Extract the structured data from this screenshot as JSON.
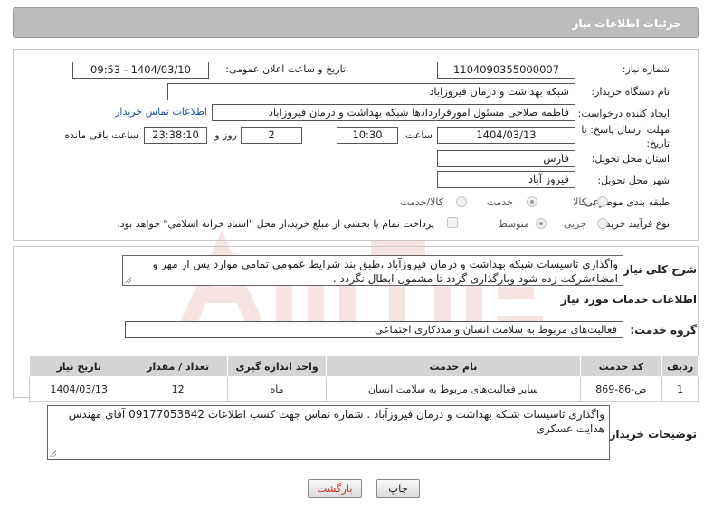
{
  "panel": {
    "title": "جزئیات اطلاعات نیاز"
  },
  "form": {
    "need_number_label": "شماره نیاز:",
    "need_number": "1104090355000007",
    "announce_label": "تاریخ و ساعت اعلان عمومی:",
    "announce_value": "1404/03/10 - 09:53",
    "buyer_org_label": "نام دستگاه خریدار:",
    "buyer_org": "شبکه بهداشت و درمان فیروزاباد",
    "creator_label": "ایجاد کننده درخواست:",
    "creator": "فاطمه صلاحی مسئول امورقراردادها شبکه بهداشت و درمان فیروزاباد",
    "contact_link": "اطلاعات تماس خریدار",
    "deadline_label_1": "مهلت ارسال پاسخ: تا",
    "deadline_label_2": "تاریخ:",
    "deadline_date": "1404/03/13",
    "time_label": "ساعت",
    "deadline_time": "10:30",
    "days_value": "2",
    "days_label": "روز و",
    "remaining_time": "23:38:10",
    "remaining_label": "ساعت باقی مانده",
    "province_label": "استان محل تحویل:",
    "province": "فارس",
    "city_label": "شهر محل تحویل:",
    "city": "فیروز آباد",
    "category_label": "طبقه بندی موضوعی:",
    "category_options": [
      "کالا",
      "خدمت",
      "کالا/خدمت"
    ],
    "category_selected": "خدمت",
    "process_label": "نوع فرآیند خرید :",
    "process_options": [
      "جزیی",
      "متوسط"
    ],
    "process_selected": "متوسط",
    "payment_note": "پرداخت تمام یا بخشی از مبلغ خرید،از محل \"اسناد خزانه اسلامی\" خواهد بود."
  },
  "description": {
    "label": "شرح کلی نیاز:",
    "text": "واگذاری تاسیسات شبکه بهداشت و درمان فیروزآباد ،طبق بند شرایط عمومی تمامی موارد پس از مهر و امضاءشرکت  زده شود وبارگذاری گردد تا مشمول ابطال نگردد ."
  },
  "services": {
    "section_title": "اطلاعات خدمات مورد نیاز",
    "group_label": "گروه خدمت:",
    "group_value": "فعالیت‌های مربوط به سلامت انسان و مددکاری اجتماعی",
    "headers": [
      "ردیف",
      "کد خدمت",
      "نام خدمت",
      "واحد اندازه گیری",
      "تعداد / مقدار",
      "تاریخ نیاز"
    ],
    "rows": [
      {
        "row": "1",
        "code": "ص-86-869",
        "name": "سایر فعالیت‌های مربوط به سلامت انسان",
        "unit": "ماه",
        "qty": "12",
        "date": "1404/03/13"
      }
    ]
  },
  "buyer_notes": {
    "label": "توضیحات خریدار:",
    "text": "واگذاری تاسیسات شبکه بهداشت و درمان فیروزآباد . شماره تماس جهت کسب اطلاعات 09177053842  آقای مهندس هدایت عسکری"
  },
  "buttons": {
    "print": "چاپ",
    "back": "بازگشت"
  },
  "colors": {
    "header_bg": "#bcbcbc",
    "link": "#1a4fa0",
    "back_text": "#c0392b",
    "watermark": "#c0392b"
  }
}
